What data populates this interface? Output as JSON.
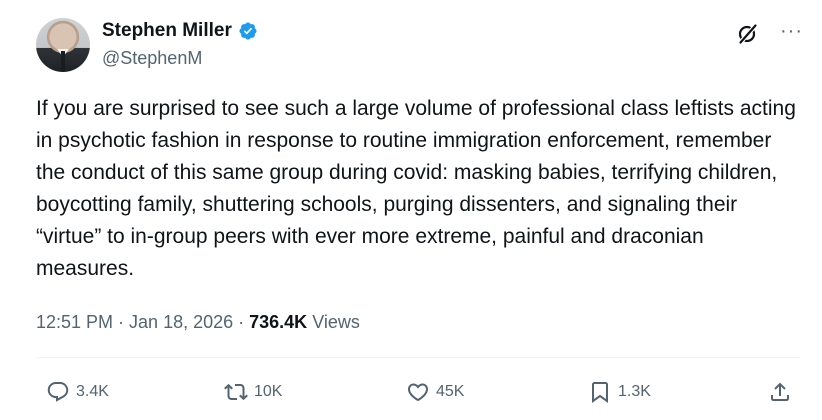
{
  "author": {
    "name": "Stephen Miller",
    "handle": "@StephenM"
  },
  "tweet": {
    "text": "If you are surprised to see such a large volume of professional class leftists acting in psychotic fashion in response to routine immigration enforcement, remember the conduct of this same group during covid: masking babies, terrifying children, boycotting family, shuttering schools, purging dissenters, and signaling their “virtue” to in-group peers with ever more extreme, painful and draconian measures.",
    "time": "12:51 PM",
    "sep1": "·",
    "date": "Jan 18, 2026",
    "sep2": "·",
    "views_count": "736.4K",
    "views_label": "Views"
  },
  "actions": {
    "replies": "3.4K",
    "reposts": "10K",
    "likes": "45K",
    "bookmarks": "1.3K"
  },
  "icons": {
    "verified": "verified-badge-icon",
    "grok": "grok-icon",
    "more": "more-icon",
    "reply": "reply-icon",
    "repost": "repost-icon",
    "like": "heart-icon",
    "bookmark": "bookmark-icon",
    "share": "share-icon"
  },
  "colors": {
    "verified": "#1d9bf0",
    "text": "#0f1419",
    "secondary": "#536471"
  }
}
